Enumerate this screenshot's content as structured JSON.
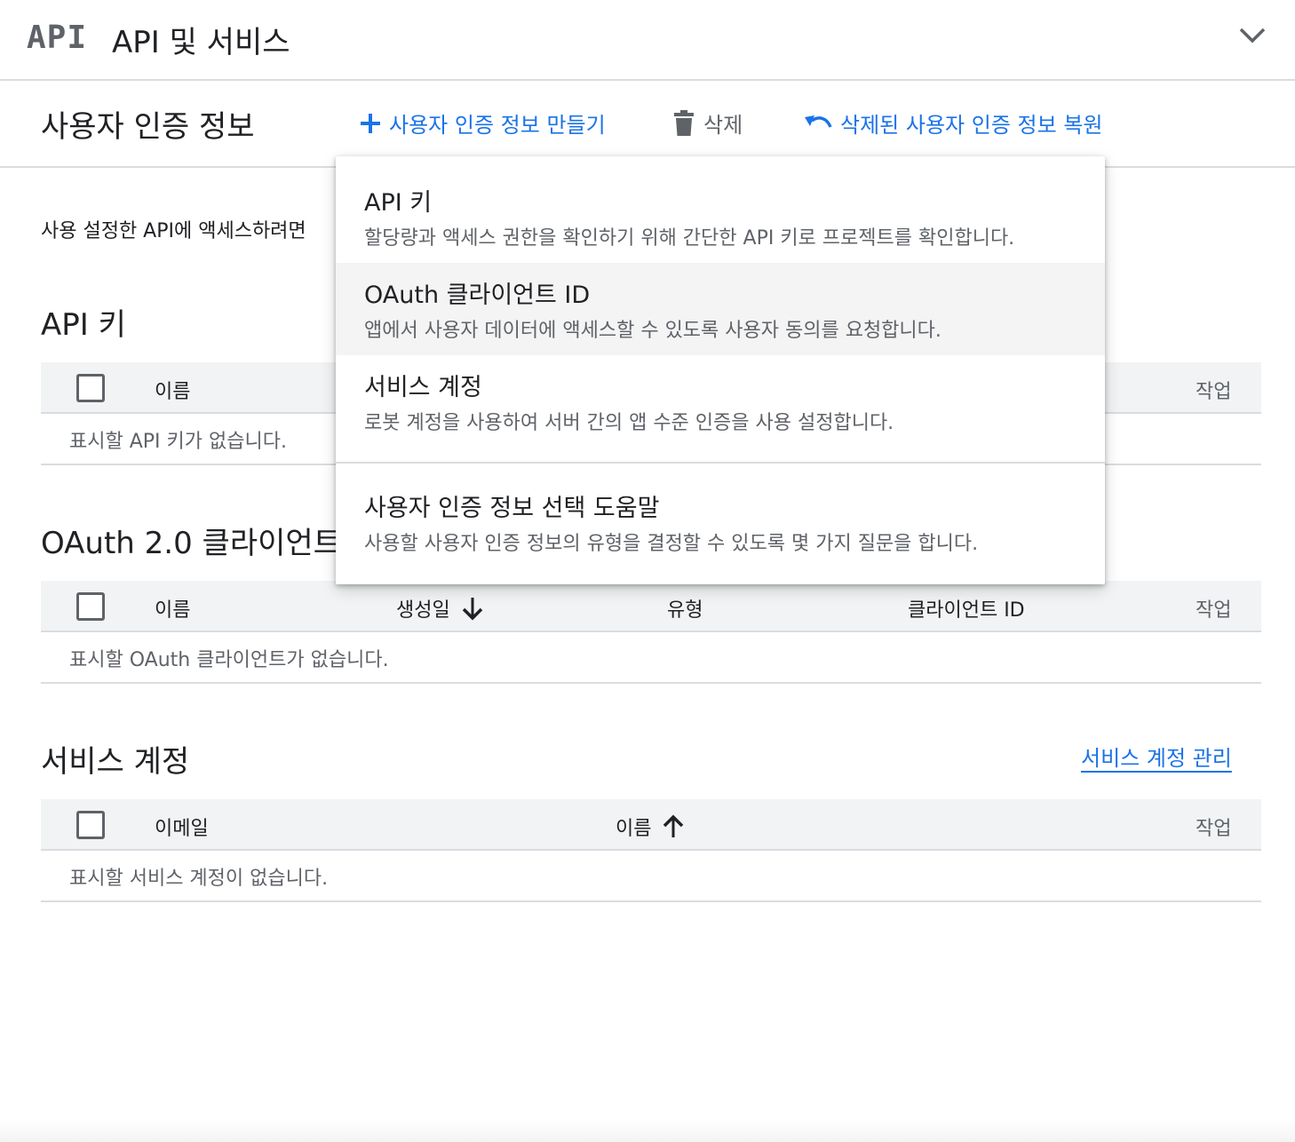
{
  "header": {
    "logo_text": "API",
    "title": "API 및 서비스",
    "chevron_icon": "chevron-down-icon"
  },
  "actionbar": {
    "title": "사용자 인증 정보",
    "create_label": "사용자 인증 정보 만들기",
    "delete_label": "삭제",
    "restore_label": "삭제된 사용자 인증 정보 복원"
  },
  "intro_text": "사용 설정한 API에 액세스하려면",
  "api_keys": {
    "title": "API 키",
    "columns": {
      "name": "이름",
      "actions": "작업"
    },
    "empty": "표시할 API 키가 없습니다."
  },
  "oauth": {
    "title": "OAuth 2.0 클라이언트",
    "columns": {
      "name": "이름",
      "created": "생성일",
      "type": "유형",
      "client_id": "클라이언트 ID",
      "actions": "작업"
    },
    "empty": "표시할 OAuth 클라이언트가 없습니다."
  },
  "service_accounts": {
    "title": "서비스 계정",
    "manage_link": "서비스 계정 관리",
    "columns": {
      "email": "이메일",
      "name": "이름",
      "actions": "작업"
    },
    "empty": "표시할 서비스 계정이 없습니다."
  },
  "menu": {
    "items": [
      {
        "title": "API 키",
        "desc": "할당량과 액세스 권한을 확인하기 위해 간단한 API 키로 프로젝트를 확인합니다."
      },
      {
        "title": "OAuth 클라이언트 ID",
        "desc": "앱에서 사용자 데이터에 액세스할 수 있도록 사용자 동의를 요청합니다."
      },
      {
        "title": "서비스 계정",
        "desc": "로봇 계정을 사용하여 서버 간의 앱 수준 인증을 사용 설정합니다."
      },
      {
        "title": "사용자 인증 정보 선택 도움말",
        "desc": "사용할 사용자 인증 정보의 유형을 결정할 수 있도록 몇 가지 질문을 합니다."
      }
    ]
  },
  "colors": {
    "accent": "#1a73e8",
    "muted": "#5f6368",
    "header_bg": "#f1f3f4",
    "divider": "#dadce0"
  }
}
